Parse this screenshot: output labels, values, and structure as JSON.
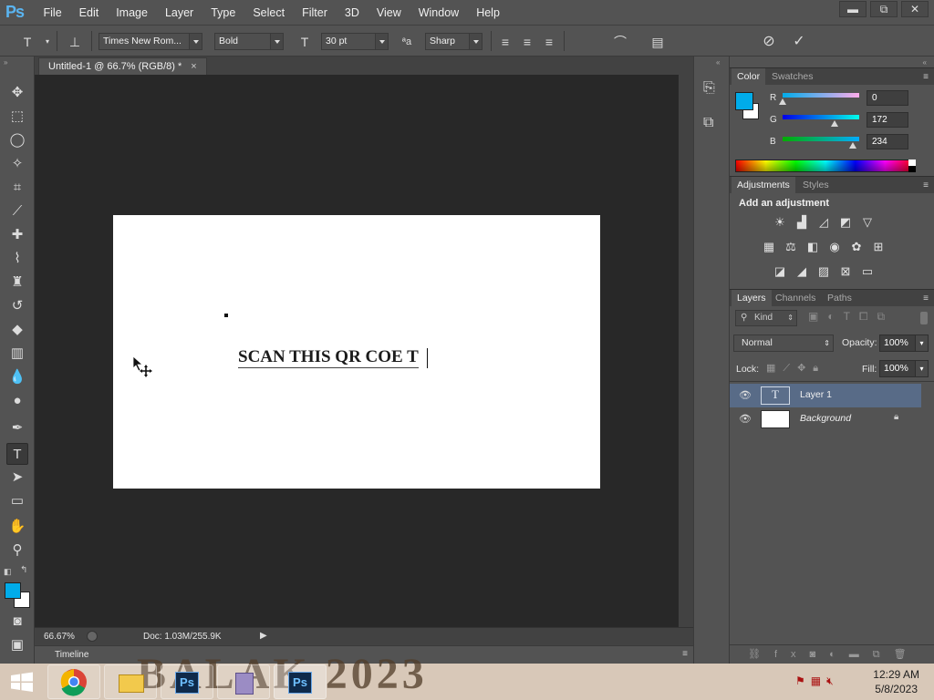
{
  "app": {
    "logo": "Ps"
  },
  "menu": [
    "File",
    "Edit",
    "Image",
    "Layer",
    "Type",
    "Select",
    "Filter",
    "3D",
    "View",
    "Window",
    "Help"
  ],
  "window_controls": {
    "minimize": "▬",
    "restore": "⧉",
    "close": "✕"
  },
  "options_bar": {
    "font_family": "Times New Rom...",
    "font_style": "Bold",
    "font_size": "30 pt",
    "antialias": "Sharp",
    "text_color": "#000000"
  },
  "document": {
    "tab_title": "Untitled-1 @ 66.7% (RGB/8) *",
    "tab_close": "×",
    "text_content": "SCAN THIS QR COE T"
  },
  "status": {
    "zoom": "66.67%",
    "doc_info": "Doc: 1.03M/255.9K"
  },
  "timeline": {
    "label": "Timeline"
  },
  "color_panel": {
    "tabs": [
      "Color",
      "Swatches"
    ],
    "foreground": "#00acea",
    "background": "#ffffff",
    "channels": [
      {
        "label": "R",
        "value": "0",
        "fraction": 0.0
      },
      {
        "label": "G",
        "value": "172",
        "fraction": 0.675
      },
      {
        "label": "B",
        "value": "234",
        "fraction": 0.918
      }
    ]
  },
  "adjustments_panel": {
    "tabs": [
      "Adjustments",
      "Styles"
    ],
    "heading": "Add an adjustment"
  },
  "layers_panel": {
    "tabs": [
      "Layers",
      "Channels",
      "Paths"
    ],
    "filter_kind": "Kind",
    "blend_mode": "Normal",
    "opacity_label": "Opacity:",
    "opacity": "100%",
    "lock_label": "Lock:",
    "fill_label": "Fill:",
    "fill": "100%",
    "layers": [
      {
        "name": "Layer 1",
        "type": "text",
        "selected": true
      },
      {
        "name": "Background",
        "type": "image",
        "selected": false,
        "locked": true
      }
    ]
  },
  "taskbar": {
    "wallpaper_text": "BALAK 2023",
    "time": "12:29 AM",
    "date": "5/8/2023",
    "ps_label": "Ps"
  }
}
